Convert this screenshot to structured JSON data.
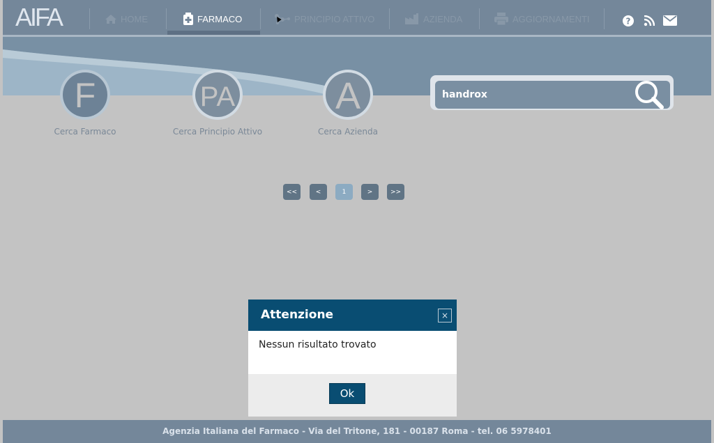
{
  "header": {
    "logo": "AIFA",
    "nav": [
      {
        "label": "HOME",
        "icon": "home-icon"
      },
      {
        "label": "FARMACO",
        "icon": "medicine-icon",
        "active": true
      },
      {
        "label": "PRINCIPIO ATTIVO",
        "icon": "molecule-icon"
      },
      {
        "label": "AZIENDA",
        "icon": "factory-icon"
      },
      {
        "label": "AGGIORNAMENTI",
        "icon": "printer-icon"
      }
    ],
    "top_icons": [
      "help-icon",
      "rss-icon",
      "mail-icon"
    ]
  },
  "search_links": [
    {
      "letter": "F",
      "caption": "Cerca Farmaco"
    },
    {
      "letter": "PA",
      "caption": "Cerca Principio Attivo"
    },
    {
      "letter": "A",
      "caption": "Cerca Azienda"
    }
  ],
  "search": {
    "value": "handrox",
    "icon": "search-icon"
  },
  "pagination": {
    "first": "<<",
    "prev": "<",
    "current": "1",
    "next": ">",
    "last": ">>"
  },
  "dialog": {
    "title": "Attenzione",
    "close": "×",
    "message": "Nessun risultato trovato",
    "ok": "Ok"
  },
  "footer": {
    "text": "Agenzia Italiana del Farmaco - Via del Tritone, 181 - 00187 Roma - tel. 06 5978401"
  },
  "colors": {
    "nav_bg": "#74879a",
    "dialog_header": "#094d72",
    "page_bg": "#c3c3c3"
  }
}
